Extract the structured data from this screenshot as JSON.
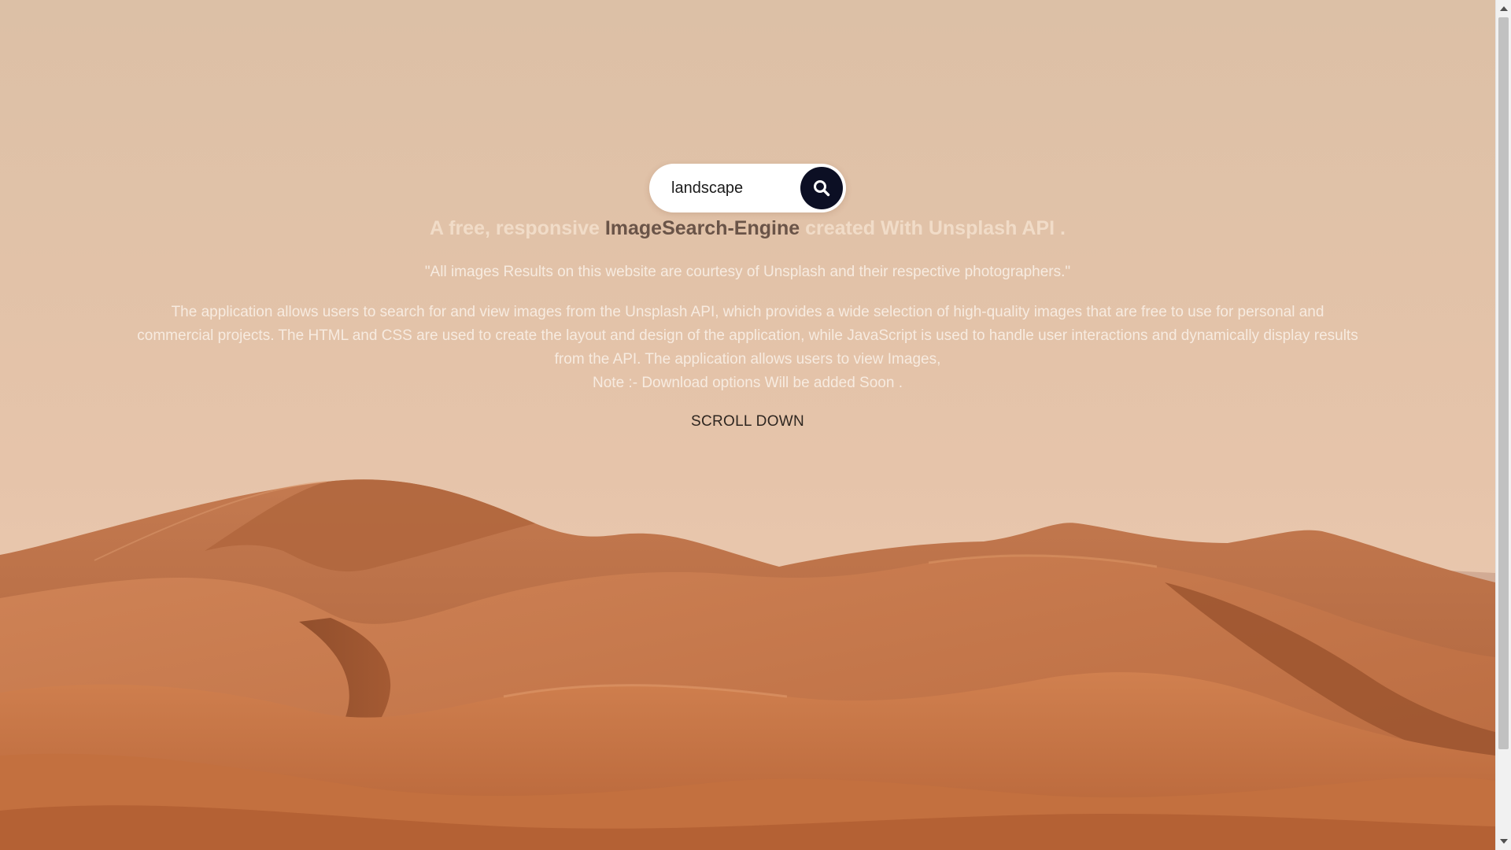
{
  "search": {
    "value": "landscape",
    "button_icon": "search-icon"
  },
  "hero": {
    "headline_start": "A free, responsive ",
    "headline_highlight": "ImageSearch-Engine",
    "headline_end": " created With Unsplash API .",
    "quote": "\"All images Results on this website are courtesy of Unsplash and their respective photographers.\"",
    "description_main": "The application allows users to search for and view images from the Unsplash API, which provides a wide selection of high-quality images that are free to use for personal and commercial projects. The HTML and CSS are used to create the layout and design of the application, while JavaScript is used to handle user interactions and dynamically display results from the API. The application allows users to view Images,",
    "description_note": "Note :- Download options Will be added Soon .",
    "scroll_down": "SCROLL DOWN"
  },
  "colors": {
    "sky_top": "#dcc0a6",
    "sky_bottom": "#ecc8ae",
    "dune_light": "#c8784c",
    "dune_dark": "#93522f",
    "search_button": "#0c0f24",
    "headline_highlight": "#6a5448"
  }
}
